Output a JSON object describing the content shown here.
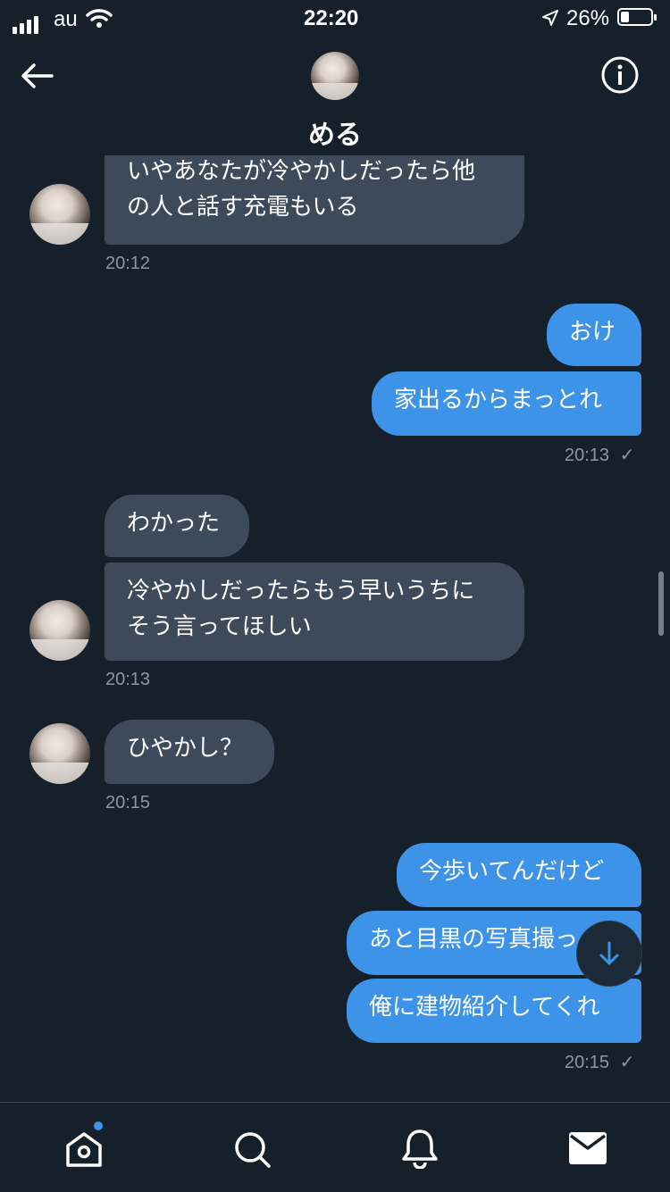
{
  "status": {
    "carrier": "au",
    "time": "22:20",
    "battery": "26%"
  },
  "header": {
    "contact_name": "める"
  },
  "messages": [
    {
      "text": "いやあなたが冷やかしだったら他\nの人と話す充電もいる"
    },
    {
      "text": "おけ"
    },
    {
      "text": "家出るからまっとれ"
    },
    {
      "text": "わかった"
    },
    {
      "text": "冷やかしだったらもう早いうちに\nそう言ってほしい"
    },
    {
      "text": "ひやかし？"
    },
    {
      "text": "今歩いてんだけど"
    },
    {
      "text": "あと目黒の写真撮っ"
    },
    {
      "text": "俺に建物紹介してくれ"
    }
  ],
  "timestamps": [
    "20:12",
    "20:13",
    "20:13",
    "20:15",
    "20:15"
  ],
  "icons": {
    "back": "arrow-left-icon",
    "info": "info-icon",
    "scroll_down": "arrow-down-icon",
    "home": "home-icon",
    "search": "search-icon",
    "notifications": "bell-icon",
    "messages": "mail-icon"
  },
  "colors": {
    "background": "#15202b",
    "sent_bubble": "#3d93e8",
    "received_bubble": "#3d4a5a",
    "timestamp": "#8899a6"
  }
}
